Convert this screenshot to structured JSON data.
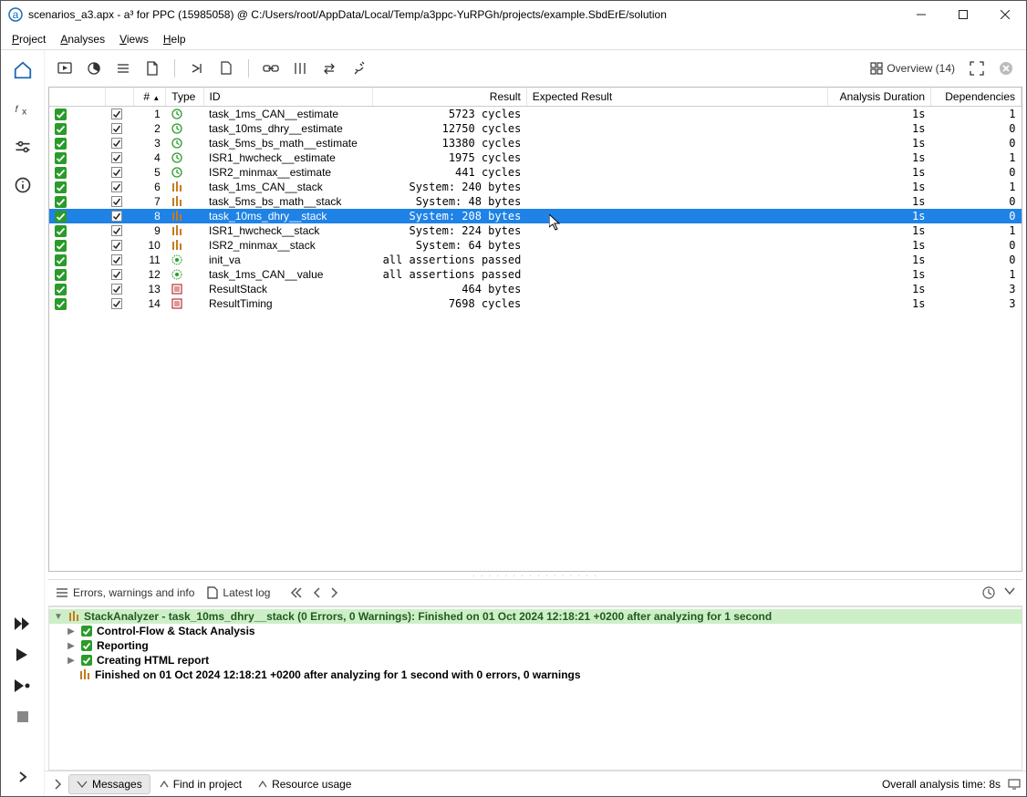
{
  "window": {
    "title": "scenarios_a3.apx - a³ for PPC (15985058) @ C:/Users/root/AppData/Local/Temp/a3ppc-YuRPGh/projects/example.SbdErE/solution"
  },
  "menubar": {
    "project": "Project",
    "analyses": "Analyses",
    "views": "Views",
    "help": "Help"
  },
  "toolbar": {
    "overview_label": "Overview (14)"
  },
  "table": {
    "headers": {
      "num": "#",
      "type": "Type",
      "id": "ID",
      "result": "Result",
      "expected": "Expected Result",
      "duration": "Analysis Duration",
      "deps": "Dependencies"
    },
    "rows": [
      {
        "num": "1",
        "type": "timing",
        "id": "task_1ms_CAN__estimate",
        "result": "5723 cycles",
        "duration": "1s",
        "deps": "1"
      },
      {
        "num": "2",
        "type": "timing",
        "id": "task_10ms_dhry__estimate",
        "result": "12750 cycles",
        "duration": "1s",
        "deps": "0"
      },
      {
        "num": "3",
        "type": "timing",
        "id": "task_5ms_bs_math__estimate",
        "result": "13380 cycles",
        "duration": "1s",
        "deps": "0"
      },
      {
        "num": "4",
        "type": "timing",
        "id": "ISR1_hwcheck__estimate",
        "result": "1975 cycles",
        "duration": "1s",
        "deps": "1"
      },
      {
        "num": "5",
        "type": "timing",
        "id": "ISR2_minmax__estimate",
        "result": "441 cycles",
        "duration": "1s",
        "deps": "0"
      },
      {
        "num": "6",
        "type": "stack",
        "id": "task_1ms_CAN__stack",
        "result": "System: 240 bytes",
        "duration": "1s",
        "deps": "1"
      },
      {
        "num": "7",
        "type": "stack",
        "id": "task_5ms_bs_math__stack",
        "result": "System: 48 bytes",
        "duration": "1s",
        "deps": "0"
      },
      {
        "num": "8",
        "type": "stack",
        "id": "task_10ms_dhry__stack",
        "result": "System: 208 bytes",
        "duration": "1s",
        "deps": "0",
        "selected": true
      },
      {
        "num": "9",
        "type": "stack",
        "id": "ISR1_hwcheck__stack",
        "result": "System: 224 bytes",
        "duration": "1s",
        "deps": "1"
      },
      {
        "num": "10",
        "type": "stack",
        "id": "ISR2_minmax__stack",
        "result": "System: 64 bytes",
        "duration": "1s",
        "deps": "0"
      },
      {
        "num": "11",
        "type": "value",
        "id": "init_va",
        "result": "all assertions passed",
        "duration": "1s",
        "deps": "0"
      },
      {
        "num": "12",
        "type": "value",
        "id": "task_1ms_CAN__value",
        "result": "all assertions passed",
        "duration": "1s",
        "deps": "1"
      },
      {
        "num": "13",
        "type": "report",
        "id": "ResultStack",
        "result": "464 bytes",
        "duration": "1s",
        "deps": "3"
      },
      {
        "num": "14",
        "type": "report",
        "id": "ResultTiming",
        "result": "7698 cycles",
        "duration": "1s",
        "deps": "3"
      }
    ]
  },
  "logtabs": {
    "errors": "Errors, warnings and info",
    "latest": "Latest log"
  },
  "log": {
    "header": "StackAnalyzer - task_10ms_dhry__stack (0 Errors, 0 Warnings): Finished on 01 Oct 2024 12:18:21 +0200 after analyzing for 1 second",
    "line1": "Control-Flow & Stack Analysis",
    "line2": "Reporting",
    "line3": "Creating HTML report",
    "line4": "Finished on 01 Oct 2024 12:18:21 +0200 after analyzing for 1 second with 0 errors, 0 warnings"
  },
  "statusbar": {
    "messages": "Messages",
    "find": "Find in project",
    "resource": "Resource usage",
    "time": "Overall analysis time: 8s"
  }
}
